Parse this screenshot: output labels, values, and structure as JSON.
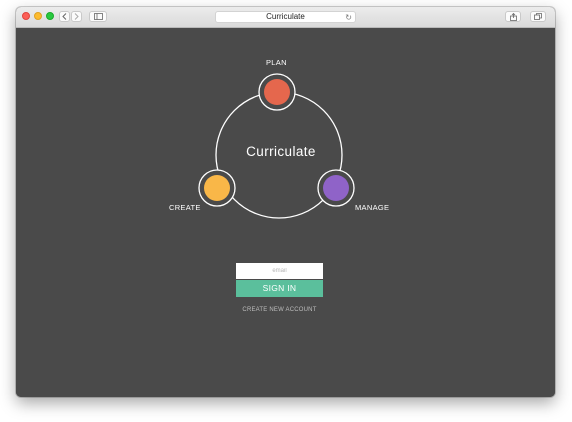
{
  "browser": {
    "tab_title": "Curriculate",
    "colors": {
      "close": "#fc5f57",
      "minimize": "#fdbb2e",
      "zoom": "#28c840"
    },
    "icons": [
      "back-icon",
      "forward-icon",
      "sidebar-icon",
      "reload-icon",
      "share-icon",
      "tabs-icon"
    ]
  },
  "cycle": {
    "brand": "Curriculate",
    "nodes": [
      {
        "label": "PLAN",
        "color": "#e5674d"
      },
      {
        "label": "MANAGE",
        "color": "#8f63c8"
      },
      {
        "label": "CREATE",
        "color": "#f9b748"
      }
    ]
  },
  "signin": {
    "email_placeholder": "email",
    "button_label": "SIGN IN",
    "create_account_label": "CREATE NEW ACCOUNT",
    "button_color": "#5bbf9c"
  }
}
